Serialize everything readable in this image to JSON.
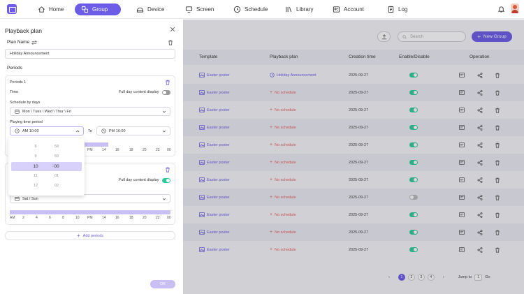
{
  "nav": {
    "items": [
      {
        "label": "Home",
        "icon": "home-icon",
        "active": false
      },
      {
        "label": "Group",
        "icon": "group-icon",
        "active": true
      },
      {
        "label": "Device",
        "icon": "device-icon",
        "active": false
      },
      {
        "label": "Screen",
        "icon": "screen-icon",
        "active": false
      },
      {
        "label": "Schedule",
        "icon": "clock-icon",
        "active": false
      },
      {
        "label": "Library",
        "icon": "library-icon",
        "active": false
      },
      {
        "label": "Account",
        "icon": "account-icon",
        "active": false
      },
      {
        "label": "Log",
        "icon": "log-icon",
        "active": false
      }
    ]
  },
  "toolbar": {
    "search_placeholder": "Search",
    "new_group_label": "New Group"
  },
  "table": {
    "headers": {
      "template": "Template",
      "plan": "Playback plan",
      "created": "Creation time",
      "enable": "Enable/Disable",
      "operation": "Operation"
    },
    "rows": [
      {
        "template": "Easter poster",
        "plan": "Holiday Announcement",
        "has_plan": true,
        "date": "2025-09-27",
        "enabled": true
      },
      {
        "template": "Easter poster",
        "plan": "No schedule",
        "has_plan": false,
        "date": "2025-09-27",
        "enabled": true
      },
      {
        "template": "Easter poster",
        "plan": "No schedule",
        "has_plan": false,
        "date": "2025-09-27",
        "enabled": true
      },
      {
        "template": "Easter poster",
        "plan": "No schedule",
        "has_plan": false,
        "date": "2025-09-27",
        "enabled": true
      },
      {
        "template": "Easter poster",
        "plan": "No schedule",
        "has_plan": false,
        "date": "2025-09-27",
        "enabled": true
      },
      {
        "template": "Easter poster",
        "plan": "No schedule",
        "has_plan": false,
        "date": "2025-09-27",
        "enabled": true
      },
      {
        "template": "Easter poster",
        "plan": "No schedule",
        "has_plan": false,
        "date": "2025-09-27",
        "enabled": true
      },
      {
        "template": "Easter poster",
        "plan": "No schedule",
        "has_plan": false,
        "date": "2025-09-27",
        "enabled": false
      },
      {
        "template": "Easter poster",
        "plan": "No schedule",
        "has_plan": false,
        "date": "2025-09-27",
        "enabled": true
      },
      {
        "template": "Easter poster",
        "plan": "No schedule",
        "has_plan": false,
        "date": "2025-09-27",
        "enabled": true
      },
      {
        "template": "Easter poster",
        "plan": "No schedule",
        "has_plan": false,
        "date": "2025-09-27",
        "enabled": true
      }
    ]
  },
  "pagination": {
    "pages": [
      "1",
      "2",
      "3",
      "4"
    ],
    "current": "1",
    "jump_label": "Jump to",
    "jump_value": "1",
    "go_label": "Go"
  },
  "panel": {
    "title": "Playback plan",
    "plan_name_label": "Plan Name",
    "plan_name_value": "Holiday Announcement",
    "periods_label": "Periods",
    "period1": {
      "title": "Periods 1",
      "time_label": "Time",
      "full_day_label": "Full day content display",
      "full_day_on": false,
      "schedule_label": "Schedule by days",
      "days_value": "Mon \\ Tues \\ Wed \\ Thur \\ Fri",
      "time_period_label": "Playing time period",
      "start_time": "AM 10:00",
      "to_label": "To",
      "end_time": "PM 16:00",
      "timeline_labels": [
        "PM",
        "14",
        "16",
        "18",
        "20",
        "22",
        "00"
      ]
    },
    "period2": {
      "full_day_label": "Full day content display",
      "full_day_on": true,
      "days_value": "Sat / Sun",
      "timeline_labels": [
        "AM",
        "2",
        "4",
        "6",
        "8",
        "10",
        "PM",
        "14",
        "16",
        "18",
        "20",
        "22",
        "00"
      ]
    },
    "add_periods_label": "Add periods",
    "ok_label": "OK"
  },
  "time_picker": {
    "hours": [
      "8",
      "9",
      "10",
      "11",
      "12"
    ],
    "minutes": [
      "58",
      "59",
      "00",
      "01",
      "02"
    ],
    "selected_hour": "10",
    "selected_minute": "00"
  },
  "colors": {
    "accent": "#6c5ce7",
    "enabled": "#2ecc9a",
    "no_schedule": "#e85d5d"
  }
}
